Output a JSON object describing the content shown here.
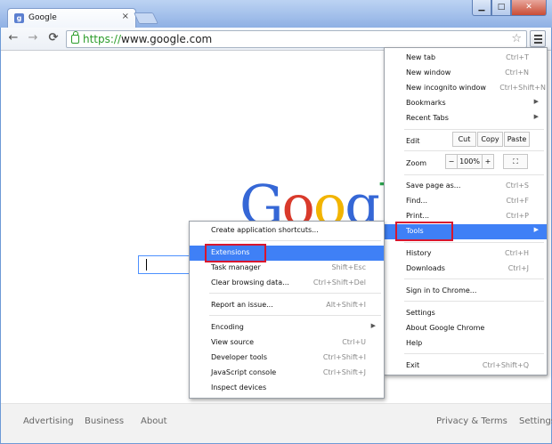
{
  "tab": {
    "title": "Google",
    "favicon": "g"
  },
  "window_buttons": {
    "minimize": "▁",
    "maximize": "□",
    "close": "✕"
  },
  "toolbar": {
    "back": "←",
    "forward": "→",
    "reload": "⟳",
    "url_scheme": "https://",
    "url_host": "www.google.com",
    "star": "☆"
  },
  "logo": {
    "letters": [
      "G",
      "o",
      "o",
      "g",
      "l"
    ],
    "colors": [
      "#3567d6",
      "#d93a2b",
      "#f2b400",
      "#3567d6",
      "#2aa24d"
    ]
  },
  "footer": {
    "left": [
      "Advertising",
      "Business",
      "About"
    ],
    "right": [
      "Privacy & Terms",
      "Settings"
    ]
  },
  "main_menu": {
    "new_tab": {
      "label": "New tab",
      "shortcut": "Ctrl+T"
    },
    "new_window": {
      "label": "New window",
      "shortcut": "Ctrl+N"
    },
    "new_incognito": {
      "label": "New incognito window",
      "shortcut": "Ctrl+Shift+N"
    },
    "bookmarks": {
      "label": "Bookmarks"
    },
    "recent_tabs": {
      "label": "Recent Tabs"
    },
    "edit": {
      "label": "Edit",
      "cut": "Cut",
      "copy": "Copy",
      "paste": "Paste"
    },
    "zoom": {
      "label": "Zoom",
      "minus": "−",
      "value": "100%",
      "plus": "+",
      "fullscreen": "⛶"
    },
    "save_page": {
      "label": "Save page as...",
      "shortcut": "Ctrl+S"
    },
    "find": {
      "label": "Find...",
      "shortcut": "Ctrl+F"
    },
    "print": {
      "label": "Print...",
      "shortcut": "Ctrl+P"
    },
    "tools": {
      "label": "Tools"
    },
    "history": {
      "label": "History",
      "shortcut": "Ctrl+H"
    },
    "downloads": {
      "label": "Downloads",
      "shortcut": "Ctrl+J"
    },
    "sign_in": {
      "label": "Sign in to Chrome..."
    },
    "settings": {
      "label": "Settings"
    },
    "about": {
      "label": "About Google Chrome"
    },
    "help": {
      "label": "Help"
    },
    "exit": {
      "label": "Exit",
      "shortcut": "Ctrl+Shift+Q"
    }
  },
  "tools_menu": {
    "create_shortcuts": {
      "label": "Create application shortcuts..."
    },
    "extensions": {
      "label": "Extensions"
    },
    "task_manager": {
      "label": "Task manager",
      "shortcut": "Shift+Esc"
    },
    "clear_browsing": {
      "label": "Clear browsing data...",
      "shortcut": "Ctrl+Shift+Del"
    },
    "report_issue": {
      "label": "Report an issue...",
      "shortcut": "Alt+Shift+I"
    },
    "encoding": {
      "label": "Encoding"
    },
    "view_source": {
      "label": "View source",
      "shortcut": "Ctrl+U"
    },
    "developer_tools": {
      "label": "Developer tools",
      "shortcut": "Ctrl+Shift+I"
    },
    "js_console": {
      "label": "JavaScript console",
      "shortcut": "Ctrl+Shift+J"
    },
    "inspect_devices": {
      "label": "Inspect devices"
    }
  },
  "colors": {
    "highlight": "#3f80f6",
    "annotation_box": "#d8162e"
  }
}
